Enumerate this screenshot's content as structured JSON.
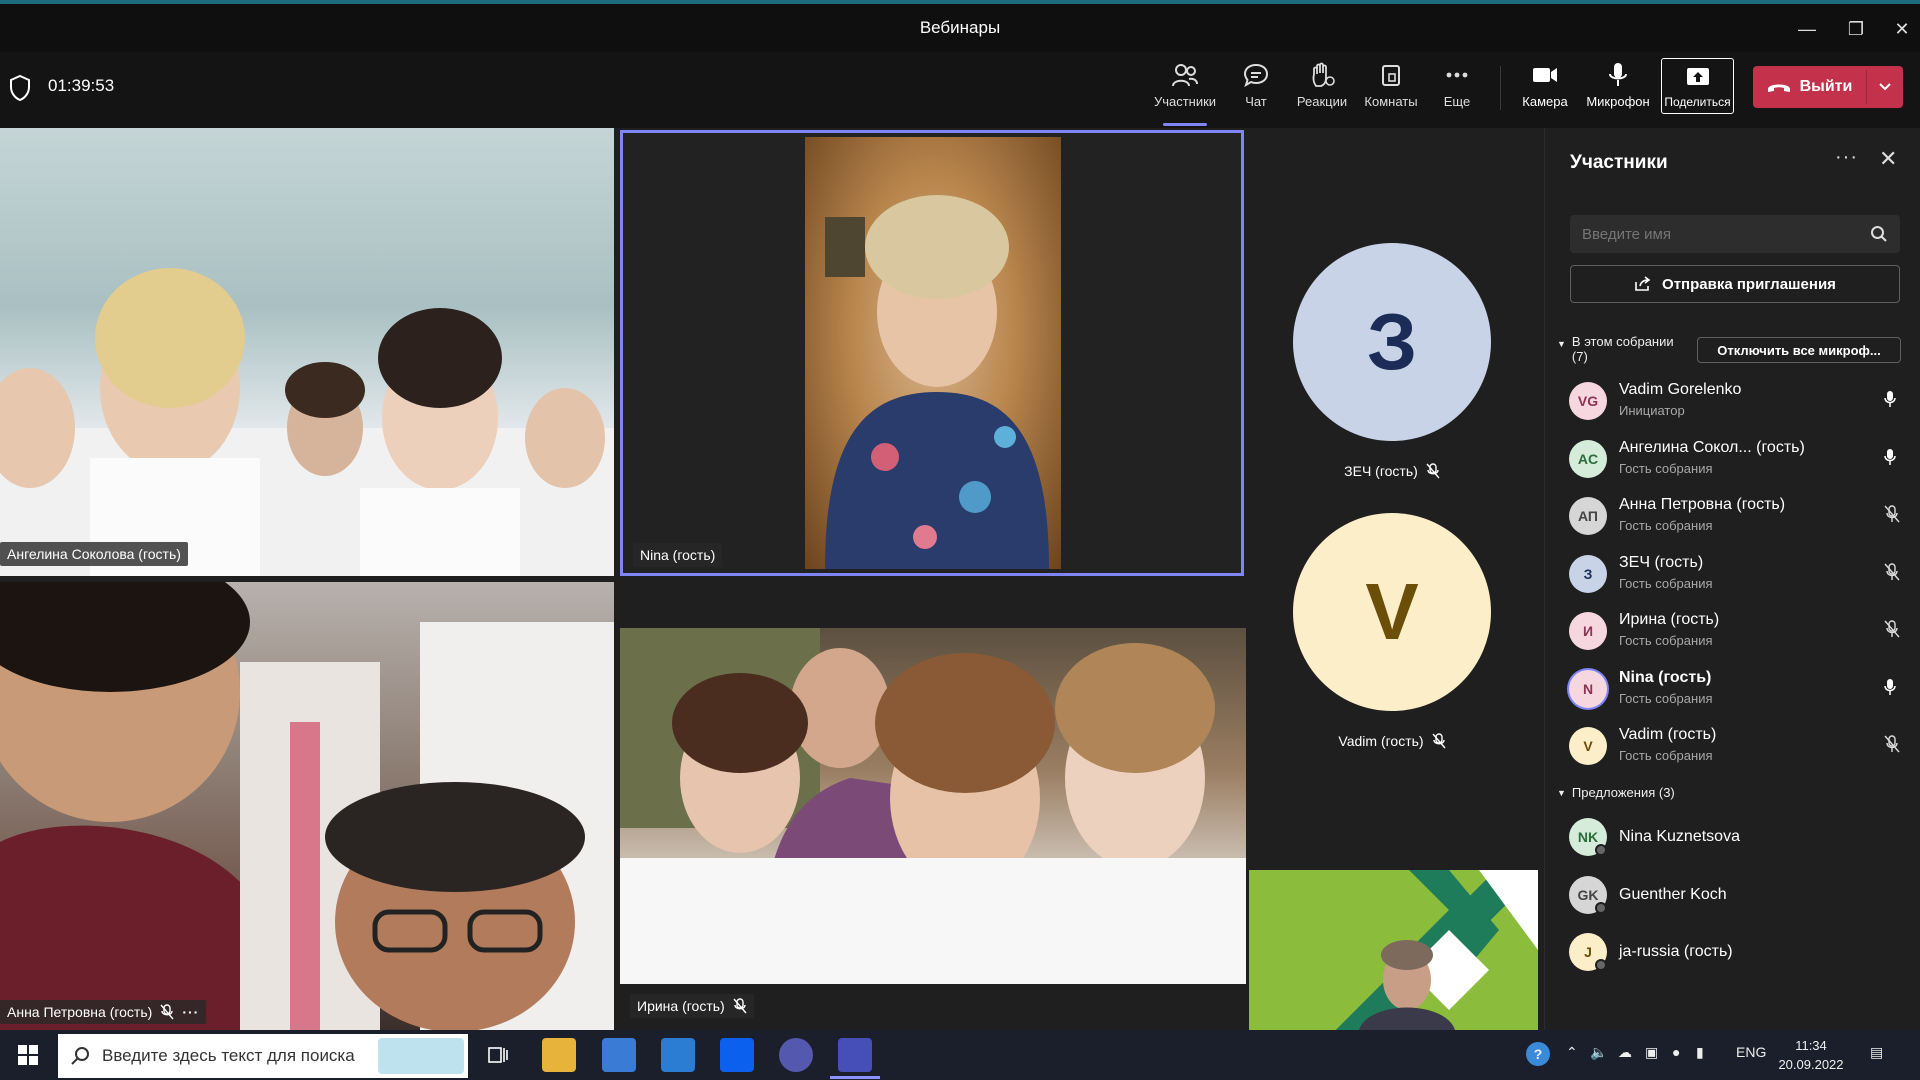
{
  "window": {
    "title": "Вебинары"
  },
  "meeting": {
    "timer": "01:39:53"
  },
  "toolbar": {
    "participants": "Участники",
    "chat": "Чат",
    "reactions": "Реакции",
    "rooms": "Комнаты",
    "more": "Еще",
    "camera": "Камера",
    "mic": "Микрофон",
    "share": "Поделиться",
    "leave": "Выйти"
  },
  "tiles": {
    "t1": "Ангелина Соколова (гость)",
    "t2": "Nina (гость)",
    "t3": "Анна Петровна (гость)",
    "t4": "Ирина (гость)",
    "a1": {
      "initial": "З",
      "name": "ЗЕЧ (гость)",
      "bg": "#c8d3e8",
      "fg": "#1b2d57"
    },
    "a2": {
      "initial": "V",
      "name": "Vadim (гость)",
      "bg": "#fbeec8",
      "fg": "#6b4e08"
    }
  },
  "panel": {
    "title": "Участники",
    "search_placeholder": "Введите имя",
    "invite": "Отправка приглашения",
    "section_in": "В этом собрании",
    "section_in_count": "(7)",
    "mute_all": "Отключить все микроф...",
    "section_suggest": "Предложения (3)",
    "participants": [
      {
        "initials": "VG",
        "name": "Vadim Gorelenko",
        "role": "Инициатор",
        "bg": "#f6d7e0",
        "fg": "#8a3357",
        "mic": "on"
      },
      {
        "initials": "AC",
        "name": "Ангелина Сокол... (гость)",
        "role": "Гость собрания",
        "bg": "#d4ecd9",
        "fg": "#2c6b3b",
        "mic": "on"
      },
      {
        "initials": "АП",
        "name": "Анна Петровна (гость)",
        "role": "Гость собрания",
        "bg": "#d6d6d6",
        "fg": "#444444",
        "mic": "off"
      },
      {
        "initials": "З",
        "name": "ЗЕЧ (гость)",
        "role": "Гость собрания",
        "bg": "#c8d3e8",
        "fg": "#1b2d57",
        "mic": "off"
      },
      {
        "initials": "И",
        "name": "Ирина (гость)",
        "role": "Гость собрания",
        "bg": "#f6d7e0",
        "fg": "#8a3357",
        "mic": "off"
      },
      {
        "initials": "N",
        "name": "Nina (гость)",
        "role": "Гость собрания",
        "bg": "#f6d7e0",
        "fg": "#8a3357",
        "mic": "on"
      },
      {
        "initials": "V",
        "name": "Vadim (гость)",
        "role": "Гость собрания",
        "bg": "#fbeec8",
        "fg": "#6b4e08",
        "mic": "off"
      }
    ],
    "suggestions": [
      {
        "initials": "NK",
        "name": "Nina Kuznetsova",
        "bg": "#d4ecd9",
        "fg": "#2c6b3b"
      },
      {
        "initials": "GK",
        "name": "Guenther Koch",
        "bg": "#d6d6d6",
        "fg": "#444444"
      },
      {
        "initials": "J",
        "name": "ja-russia (гость)",
        "bg": "#fbeec8",
        "fg": "#6b4e08"
      }
    ]
  },
  "taskbar": {
    "search_placeholder": "Введите здесь текст для поиска",
    "lang": "ENG",
    "time": "11:34",
    "date": "20.09.2022"
  },
  "colors": {
    "accent": "#7f85f5",
    "leave": "#c4314b"
  }
}
